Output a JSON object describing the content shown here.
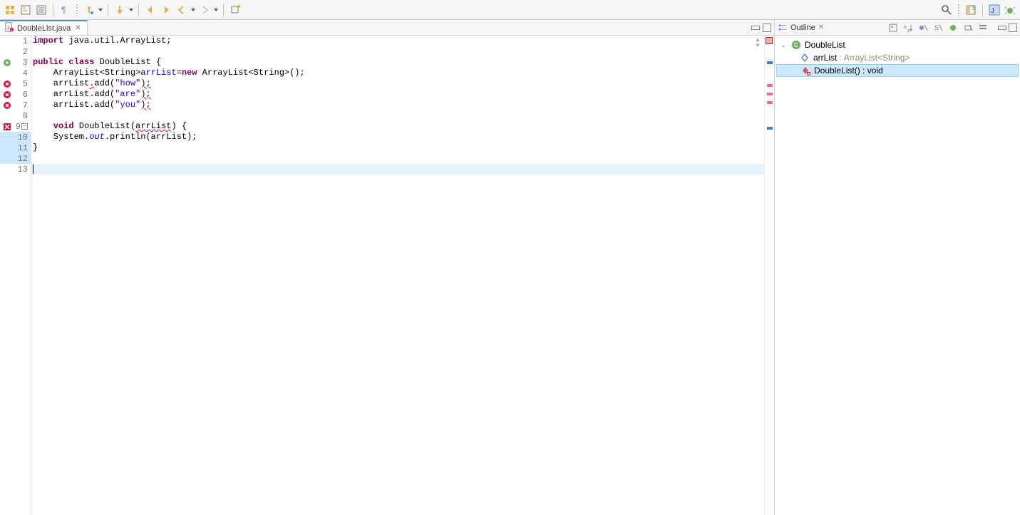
{
  "tabs": {
    "editor_tab_label": "DoubleList.java",
    "outline_tab_label": "Outline"
  },
  "code": {
    "line1_kw": "import",
    "line1_rest": " java.util.ArrayList;",
    "line3_kw1": "public",
    "line3_kw2": "class",
    "line3_rest": " DoubleList {",
    "line4_pre": "    ArrayList<String>",
    "line4_field": "arrList",
    "line4_mid": "=",
    "line4_kw": "new",
    "line4_post": " ArrayList<String>();",
    "line5_field": "    arrList",
    "line5_dot": ".",
    "line5_call": "add(",
    "line5_str": "\"how\"",
    "line5_end": ");",
    "line6_call": "    arrList.add(",
    "line6_str": "\"are\"",
    "line6_end": ");",
    "line7_call": "    arrList.add(",
    "line7_str": "\"you\"",
    "line7_end": ");",
    "line9_kw": "    void",
    "line9_mid": " DoubleList(",
    "line9_arg": "arrList",
    "line9_end": ") {",
    "line10_pre": "    System.",
    "line10_out": "out",
    "line10_post": ".println(arrList);",
    "line11": "}",
    "num": {
      "l1": "1",
      "l2": "2",
      "l3": "3",
      "l4": "4",
      "l5": "5",
      "l6": "6",
      "l7": "7",
      "l8": "8",
      "l9": "9",
      "l10": "10",
      "l11": "11",
      "l12": "12",
      "l13": "13"
    }
  },
  "outline": {
    "class_label": "DoubleList",
    "field_primary": "arrList",
    "field_sig": " : ArrayList<String>",
    "method_primary": "DoubleList()",
    "method_sig": " : void"
  }
}
